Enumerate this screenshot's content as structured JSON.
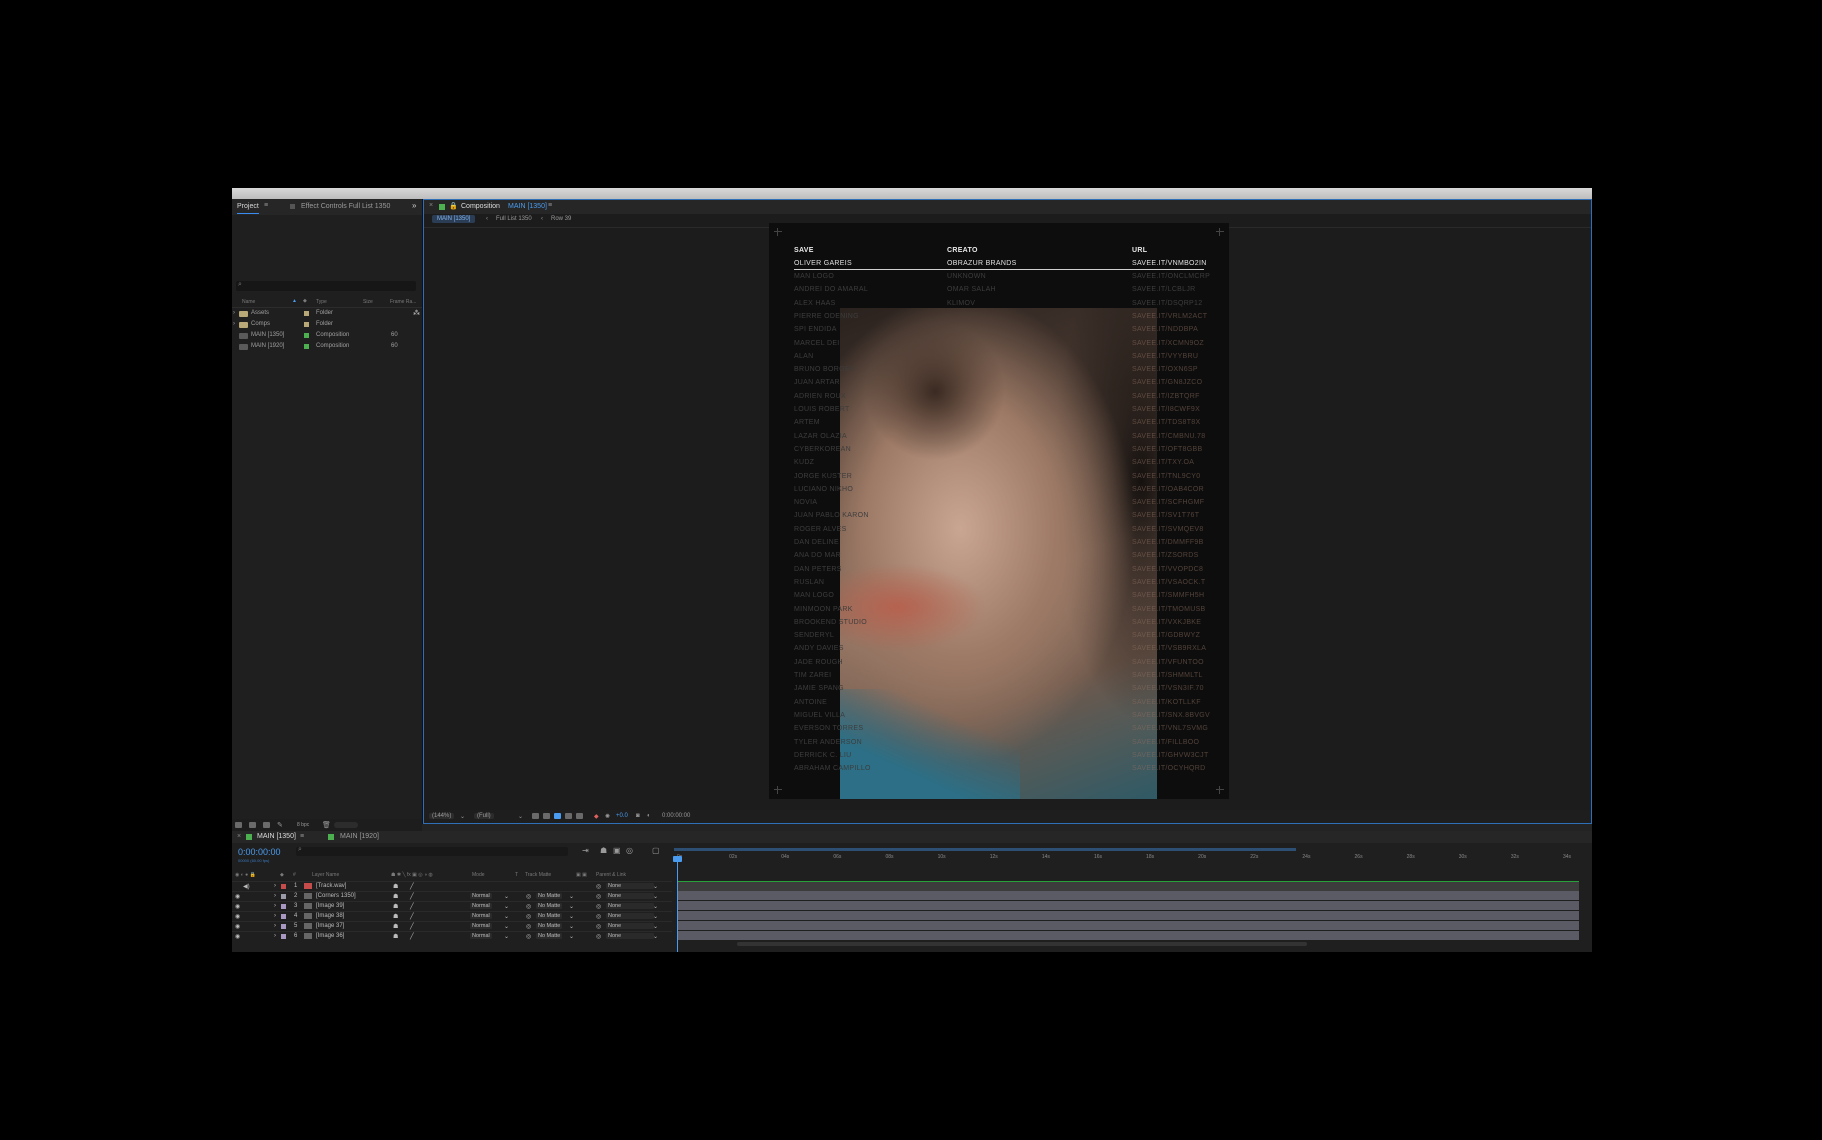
{
  "project_panel": {
    "tab_project": "Project",
    "tab_effect_controls": "Effect Controls Full List 1350",
    "columns": {
      "name": "Name",
      "type": "Type",
      "size": "Size",
      "frame_rate": "Frame Ra..."
    },
    "items": [
      {
        "name": "Assets",
        "type": "Folder",
        "frame_rate": ""
      },
      {
        "name": "Comps",
        "type": "Folder",
        "frame_rate": ""
      },
      {
        "name": "MAIN [1350]",
        "type": "Composition",
        "frame_rate": "60"
      },
      {
        "name": "MAIN [1920]",
        "type": "Composition",
        "frame_rate": "60"
      }
    ],
    "bpc": "8 bpc"
  },
  "composition_panel": {
    "tab_prefix": "Composition",
    "tab_name": "MAIN [1350]",
    "breadcrumbs": [
      "MAIN [1350]",
      "Full List 1350",
      "Row 39"
    ],
    "zoom": "(144%)",
    "resolution": "(Full)",
    "exposure": "+0.0",
    "timecode": "0:00:00:00"
  },
  "canvas": {
    "headers": [
      "SAVE",
      "CREATO",
      "URL"
    ],
    "first_row": [
      "OLIVER GAREIS",
      "OBRAZUR BRANDS",
      "SAVEE.IT/VNMBO2IN"
    ],
    "col1": [
      "MAN LOGO",
      "ANDREI DO AMARAL",
      "ALEX HAAS",
      "PIERRE ODENING",
      "SPI ENDIDA",
      "MARCEL DEI",
      "ALAN",
      "BRUNO BORGES",
      "JUAN ARTAR",
      "ADRIEN ROUX",
      "LOUIS ROBERT",
      "ARTEM",
      "LAZAR OLAZIA",
      "CYBERKOREAN",
      "KUDZ",
      "JORGE KUSTER",
      "LUCIANO NIKHO",
      "NOVIA",
      "JUAN PABLO KARON",
      "ROGER ALVES",
      "DAN DELINE",
      "ANA DO MAR",
      "DAN PETERS",
      "RUSLAN",
      "MAN LOGO",
      "MINMOON PARK",
      "BROOKEND STUDIO",
      "SENDERYL",
      "ANDY DAVIES",
      "JADE ROUGH",
      "TIM ZAREI",
      "JAMIE SPANG",
      "ANTOINE",
      "MIGUEL VILLA",
      "EVERSON TORRES",
      "TYLER ANDERSON",
      "DERRICK C. LIU",
      "ABRAHAM CAMPILLO"
    ],
    "col2": [
      "UNKNOWN",
      "OMAR SALAH",
      "KLIMOV",
      "",
      "",
      "",
      "",
      "",
      "",
      "",
      "",
      "",
      "",
      "",
      "",
      "",
      "",
      "",
      "",
      "",
      "",
      "",
      "",
      "",
      "",
      "",
      "",
      "",
      "",
      "",
      "",
      "",
      "",
      "",
      "",
      "",
      "",
      ""
    ],
    "col3": [
      "SAVEE.IT/ONCLMCRP",
      "SAVEE.IT/LCBLJR",
      "SAVEE.IT/DSQRP12",
      "SAVEE.IT/VRLM2ACT",
      "SAVEE.IT/NDDBPA",
      "SAVEE.IT/XCMN9OZ",
      "SAVEE.IT/VYYBRU",
      "SAVEE.IT/OXN6SP",
      "SAVEE.IT/GN8JZCO",
      "SAVEE.IT/IZBTQRF",
      "SAVEE.IT/I8CWF9X",
      "SAVEE.IT/TDS8T8X",
      "SAVEE.IT/CMBNU.78",
      "SAVEE.IT/OFT8GBB",
      "SAVEE.IT/TXY.OA",
      "SAVEE.IT/TNL9CY0",
      "SAVEE.IT/OAB4COR",
      "SAVEE.IT/SCFHGMF",
      "SAVEE.IT/SV1T76T",
      "SAVEE.IT/SVMQEV8",
      "SAVEE.IT/DMMFF9B",
      "SAVEE.IT/ZSORDS",
      "SAVEE.IT/VVOPDC8",
      "SAVEE.IT/VSAOCK.T",
      "SAVEE.IT/SMMFH5H",
      "SAVEE.IT/TMOMUSB",
      "SAVEE.IT/VXKJBKE",
      "SAVEE.IT/GDBWYZ",
      "SAVEE.IT/VSB9RXLA",
      "SAVEE.IT/VFUNTOO",
      "SAVEE.IT/SHMMLTL",
      "SAVEE.IT/VSN3IF.70",
      "SAVEE.IT/KOTLLKF",
      "SAVEE.IT/SNX.8BVGV",
      "SAVEE.IT/VNL7SVMG",
      "SAVEE.IT/FILLBOO",
      "SAVEE.IT/GHVW3CJT",
      "SAVEE.IT/OCYHQRD"
    ]
  },
  "timeline": {
    "tab_active": "MAIN [1350]",
    "tab_other": "MAIN [1920]",
    "timecode": "0:00:00:00",
    "timecode_sub": "00000 (60.00 fps)",
    "columns": {
      "num": "#",
      "layer_name": "Layer Name",
      "mode": "Mode",
      "t": "T",
      "track_matte": "Track Matte",
      "parent": "Parent & Link"
    },
    "layers": [
      {
        "num": "1",
        "name": "[Track.wav]",
        "mode": "",
        "matte": "",
        "parent": "None",
        "color": "#c64b4b"
      },
      {
        "num": "2",
        "name": "[Corners 1350]",
        "mode": "Normal",
        "matte": "No Matte",
        "parent": "None",
        "color": "#9a9aa8"
      },
      {
        "num": "3",
        "name": "[Image 39]",
        "mode": "Normal",
        "matte": "No Matte",
        "parent": "None",
        "color": "#a897c0"
      },
      {
        "num": "4",
        "name": "[Image 38]",
        "mode": "Normal",
        "matte": "No Matte",
        "parent": "None",
        "color": "#a897c0"
      },
      {
        "num": "5",
        "name": "[Image 37]",
        "mode": "Normal",
        "matte": "No Matte",
        "parent": "None",
        "color": "#a897c0"
      },
      {
        "num": "6",
        "name": "[Image 36]",
        "mode": "Normal",
        "matte": "No Matte",
        "parent": "None",
        "color": "#a897c0"
      }
    ],
    "ruler": [
      "0s",
      "02s",
      "04s",
      "06s",
      "08s",
      "10s",
      "12s",
      "14s",
      "16s",
      "18s",
      "20s",
      "22s",
      "24s",
      "26s",
      "28s",
      "30s",
      "32s",
      "34s"
    ]
  },
  "colors": {
    "accent": "#3a8df0",
    "composition": "#4caf50",
    "audio_bar": "#28a13c"
  }
}
